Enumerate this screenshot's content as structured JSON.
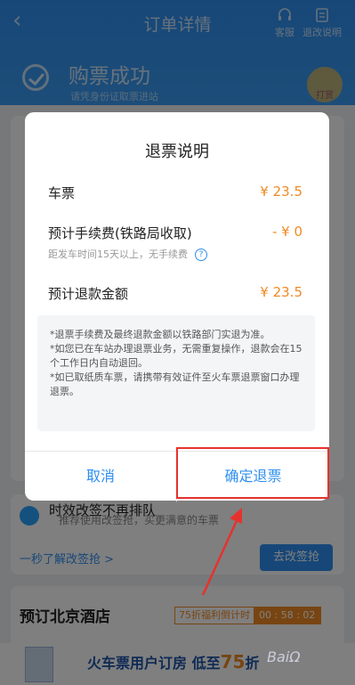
{
  "header": {
    "back_icon": "back-arrow-icon",
    "title": "订单详情",
    "service_label": "客服",
    "refund_help_label": "退改说明",
    "success_title": "购票成功",
    "success_subtitle": "请凭身份证取票进站",
    "tip_label": "打赏"
  },
  "modal": {
    "title": "退票说明",
    "rows": [
      {
        "label": "车票",
        "value": "¥ 23.5"
      },
      {
        "label": "预计手续费(铁路局收取)",
        "value": "- ¥ 0"
      },
      {
        "label": "预计退款金额",
        "value": "¥ 23.5"
      }
    ],
    "fee_note": "距发车时间15天以上，无手续费",
    "notice": [
      "*退票手续费及最终退款金额以铁路部门实退为准。",
      "*如您已在车站办理退票业务，无需重复操作，退款会在15个工作日内自动退回。",
      "*如已取纸质车票，请携带有效证件至火车票退票窗口办理退票。"
    ],
    "cancel_label": "取消",
    "confirm_label": "确定退票"
  },
  "promo": {
    "title": "时效改签不再排队",
    "subtitle": "推荐使用改签抢，买更满意的车票",
    "link": "一秒了解改签抢 >",
    "button": "去改签抢"
  },
  "hotel": {
    "title": "预订北京酒店",
    "countdown_label": "75折福利倒计时",
    "countdown_time": "00 : 58 : 02"
  },
  "banner": {
    "text_prefix": "火车票用户订房",
    "text_mid": "低至",
    "text_highlight": "75",
    "text_suffix": "折"
  },
  "colors": {
    "accent": "#2e8ff0",
    "price": "#f08a25",
    "highlight_border": "#e6322e"
  }
}
